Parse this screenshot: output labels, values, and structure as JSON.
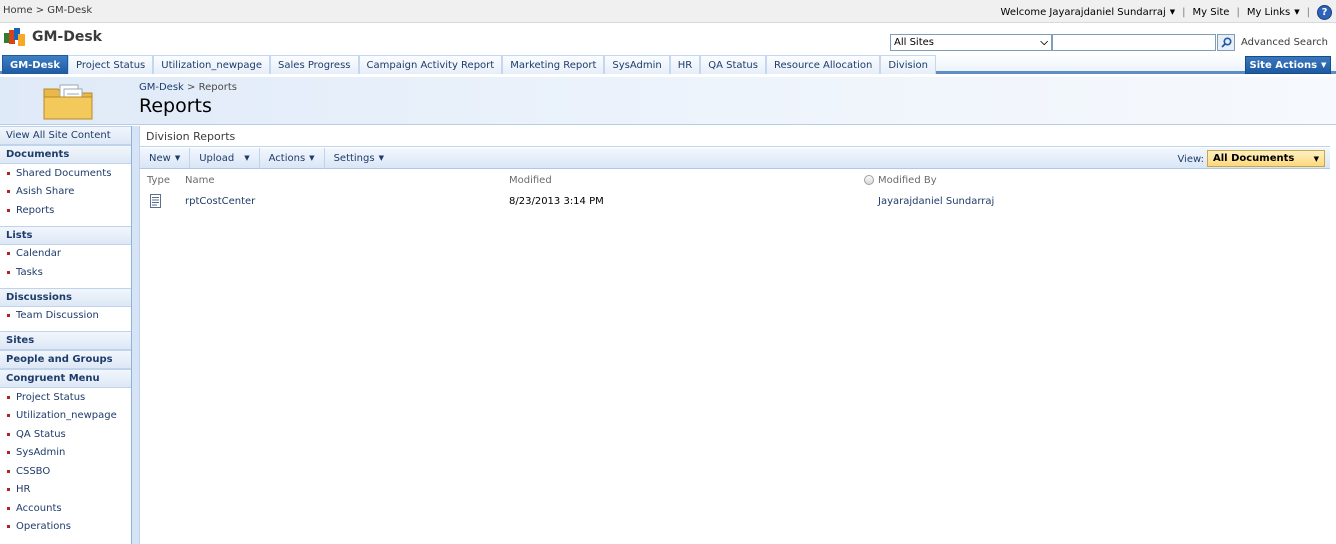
{
  "breadcrumb": {
    "home": "Home",
    "sep": ">",
    "current": "GM-Desk"
  },
  "toplinks": {
    "welcome": "Welcome Jayarajdaniel Sundarraj",
    "my_site": "My Site",
    "my_links": "My Links",
    "separator": "|"
  },
  "site": {
    "title": "GM-Desk"
  },
  "search": {
    "scope": "All Sites",
    "query": "",
    "advanced": "Advanced Search"
  },
  "nav": {
    "tabs": [
      {
        "label": "GM-Desk",
        "active": true
      },
      {
        "label": "Project Status"
      },
      {
        "label": "Utilization_newpage"
      },
      {
        "label": "Sales Progress"
      },
      {
        "label": "Campaign Activity Report"
      },
      {
        "label": "Marketing Report"
      },
      {
        "label": "SysAdmin"
      },
      {
        "label": "HR"
      },
      {
        "label": "QA Status"
      },
      {
        "label": "Resource Allocation"
      },
      {
        "label": "Division"
      }
    ],
    "site_actions": "Site Actions"
  },
  "page": {
    "crumb_site": "GM-Desk",
    "crumb_sep": ">",
    "crumb_current": "Reports",
    "title": "Reports"
  },
  "leftnav": {
    "view_all": "View All Site Content",
    "documents": {
      "heading": "Documents",
      "items": [
        "Shared Documents",
        "Asish Share",
        "Reports"
      ]
    },
    "lists": {
      "heading": "Lists",
      "items": [
        "Calendar",
        "Tasks"
      ]
    },
    "discussions": {
      "heading": "Discussions",
      "items": [
        "Team Discussion"
      ]
    },
    "sites": "Sites",
    "people": "People and Groups",
    "congruent": {
      "heading": "Congruent Menu",
      "items": [
        "Project Status",
        "Utilization_newpage",
        "QA Status",
        "SysAdmin",
        "CSSBO",
        "HR",
        "Accounts",
        "Operations"
      ]
    }
  },
  "list": {
    "title": "Division Reports",
    "toolbar": {
      "new": "New",
      "upload": "Upload",
      "actions": "Actions",
      "settings": "Settings"
    },
    "view_label": "View:",
    "view_value": "All Documents",
    "columns": {
      "type": "Type",
      "name": "Name",
      "modified": "Modified",
      "modified_by": "Modified By"
    },
    "rows": [
      {
        "name": "rptCostCenter",
        "modified": "8/23/2013 3:14 PM",
        "modified_by": "Jayarajdaniel Sundarraj"
      }
    ]
  },
  "colors": {
    "accent": "#1d5aa2",
    "link": "#1e3c6b",
    "bullet": "#b22222",
    "view_select": "#fdd87b"
  },
  "icons": [
    "sharepoint-logo-icon",
    "search-icon",
    "help-icon",
    "folder-icon",
    "document-icon",
    "presence-icon"
  ]
}
